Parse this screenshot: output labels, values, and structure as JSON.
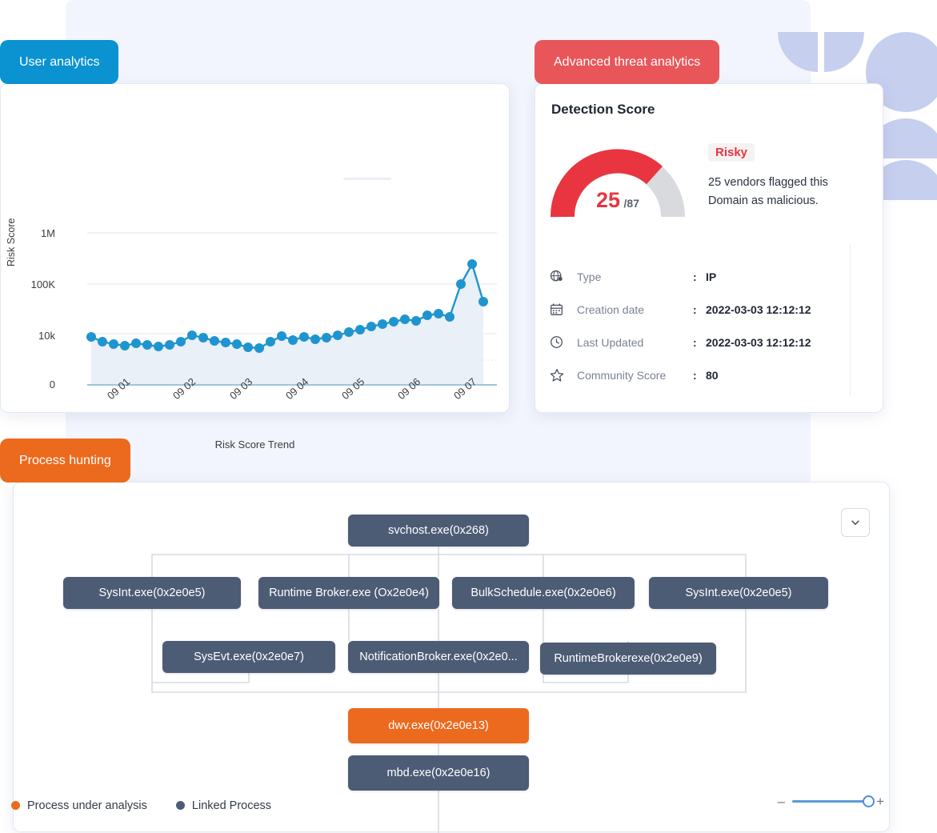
{
  "tabs": {
    "user_analytics": "User analytics",
    "advanced_threat": "Advanced threat analytics",
    "process_hunting": "Process hunting"
  },
  "colors": {
    "user_tab": "#0b92d0",
    "threat_tab": "#e8565a",
    "process_tab": "#ec6a1e",
    "chart_line": "#1f95d0",
    "gauge_red": "#e8353f",
    "gauge_track": "#d9dade",
    "node_linked": "#4d5c75",
    "node_target": "#ec6a1e",
    "decor": "#c7cfef"
  },
  "chart_data": {
    "type": "line",
    "title": "",
    "xlabel": "Risk Score Trend",
    "ylabel": "Risk Score",
    "ytick_labels": [
      "1M",
      "100K",
      "10k",
      "0"
    ],
    "xtick_labels": [
      "09 01",
      "09 02",
      "09 03",
      "09 04",
      "09 05",
      "09 06",
      "09 07"
    ],
    "grid": true,
    "scale": "log-like",
    "series": [
      {
        "name": "Risk Score",
        "values": [
          9200,
          7600,
          6900,
          6500,
          7000,
          6700,
          6200,
          6600,
          7400,
          9800,
          9100,
          7800,
          7200,
          6900,
          6300,
          6100,
          7600,
          9300,
          8000,
          9500,
          8400,
          9000,
          9800,
          11000,
          12000,
          13500,
          15000,
          16500,
          18000,
          17000,
          20000,
          21000,
          19000,
          120000,
          260000,
          60000
        ]
      }
    ]
  },
  "threat": {
    "detection_title": "Detection Score",
    "score": "25",
    "score_max": "/87",
    "risk_label": "Risky",
    "risk_description": "25 vendors flagged this Domain as malicious.",
    "meta": [
      {
        "icon": "globe-icon",
        "label": "Type",
        "sep": ":",
        "value": "IP"
      },
      {
        "icon": "calendar-icon",
        "label": "Creation date",
        "sep": ":",
        "value": "2022-03-03 12:12:12"
      },
      {
        "icon": "clock-icon",
        "label": "Last Updated",
        "sep": ":",
        "value": "2022-03-03 12:12:12"
      },
      {
        "icon": "star-icon",
        "label": "Community Score",
        "sep": ":",
        "value": "80"
      }
    ]
  },
  "process": {
    "nodes": {
      "root": "svchost.exe(0x268)",
      "l1a": "SysInt.exe(0x2e0e5)",
      "l1b": "Runtime Broker.exe (Ox2e0e4)",
      "l1c": "BulkSchedule.exe(0x2e0e6)",
      "l1d": "SysInt.exe(0x2e0e5)",
      "l2a": "SysEvt.exe(0x2e0e7)",
      "l2b": "NotificationBroker.exe(0x2e0...",
      "l2c": "RuntimeBrokerexe(0x2e0e9)",
      "target": "dwv.exe(0x2e0e13)",
      "l4": "mbd.exe(0x2e0e16)"
    },
    "legend": [
      {
        "label": "Process under analysis",
        "color": "#ec6a1e"
      },
      {
        "label": "Linked Process",
        "color": "#4d5c75"
      }
    ],
    "zoom": {
      "minus": "–",
      "plus": "+"
    }
  }
}
